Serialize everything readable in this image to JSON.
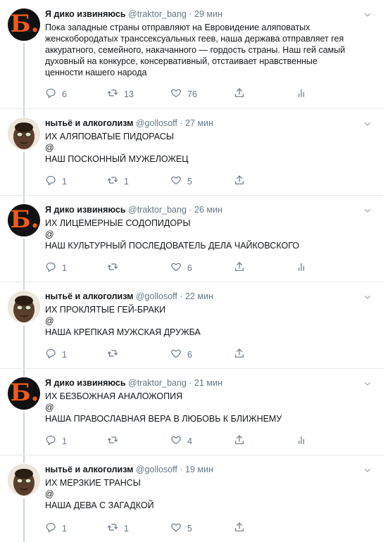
{
  "tweets": [
    {
      "avatar": "b",
      "avatar_letter": "Б.",
      "name": "Я дико извиняюсь",
      "handle": "@traktor_bang",
      "time": "29 мин",
      "lines": [
        "Пока западные страны отправляют на Евровидение аляповатых",
        "женскобородатых транссексуальных геев, наша держава отправляет гея",
        "аккуратного, семейного, накачанного — гордость страны. Наш гей самый",
        "духовный на конкурсе, консервативный, отстаивает нравственные",
        "ценности нашего народа"
      ],
      "replies": "6",
      "retweets": "13",
      "likes": "76",
      "show_stats": true
    },
    {
      "avatar": "face",
      "name": "нытьё и алкоголизм",
      "handle": "@gollosoff",
      "time": "27 мин",
      "lines": [
        "ИХ АЛЯПОВАТЫЕ ПИДОРАСЫ",
        "@",
        "НАШ ПОСКОННЫЙ МУЖЕЛОЖЕЦ"
      ],
      "replies": "1",
      "retweets": "1",
      "likes": "5",
      "show_stats": false
    },
    {
      "avatar": "b",
      "avatar_letter": "Б.",
      "name": "Я дико извиняюсь",
      "handle": "@traktor_bang",
      "time": "26 мин",
      "lines": [
        "ИХ ЛИЦЕМЕРНЫЕ СОДОПИДОРЫ",
        "@",
        "НАШ КУЛЬТУРНЫЙ ПОСЛЕДОВАТЕЛЬ ДЕЛА ЧАЙКОВСКОГО"
      ],
      "replies": "1",
      "retweets": "",
      "likes": "6",
      "show_stats": true
    },
    {
      "avatar": "face",
      "name": "нытьё и алкоголизм",
      "handle": "@gollosoff",
      "time": "22 мин",
      "lines": [
        "ИХ ПРОКЛЯТЫЕ ГЕЙ-БРАКИ",
        "@",
        "НАША КРЕПКАЯ МУЖСКАЯ ДРУЖБА"
      ],
      "replies": "1",
      "retweets": "",
      "likes": "6",
      "show_stats": false
    },
    {
      "avatar": "b",
      "avatar_letter": "Б.",
      "name": "Я дико извиняюсь",
      "handle": "@traktor_bang",
      "time": "21 мин",
      "lines": [
        "ИХ БЕЗБОЖНАЯ АНАЛОЖОПИЯ",
        "@",
        "НАША ПРАВОСЛАВНАЯ ВЕРА В ЛЮБОВЬ К БЛИЖНЕМУ"
      ],
      "replies": "1",
      "retweets": "",
      "likes": "4",
      "show_stats": true
    },
    {
      "avatar": "face",
      "name": "нытьё и алкоголизм",
      "handle": "@gollosoff",
      "time": "19 мин",
      "lines": [
        "ИХ МЕРЗКИЕ ТРАНСЫ",
        "@",
        "НАША ДЕВА С ЗАГАДКОЙ"
      ],
      "replies": "1",
      "retweets": "1",
      "likes": "5",
      "show_stats": false
    }
  ],
  "colors": {
    "text": "#14171a",
    "secondary": "#657786",
    "thread_line": "#ccd6dd",
    "avatar_b_bg": "#111111",
    "avatar_b_letter": "#f05a1a"
  },
  "icons": {
    "reply": "reply-icon",
    "retweet": "retweet-icon",
    "like": "heart-icon",
    "share": "share-icon",
    "stats": "stats-icon",
    "menu": "chevron-down-icon"
  }
}
